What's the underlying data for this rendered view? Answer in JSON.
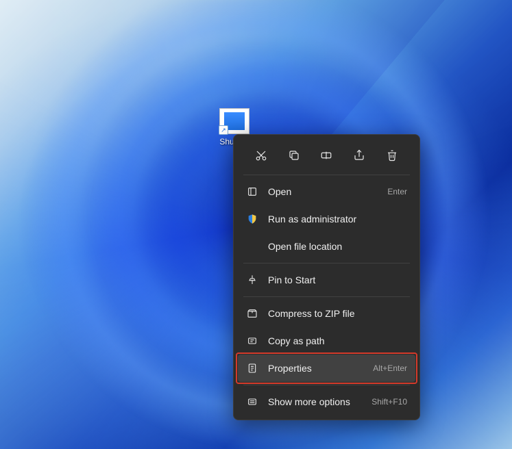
{
  "desktop": {
    "icon_label": "Shutdown",
    "icon_label_truncated": "Shutd…"
  },
  "context_menu": {
    "top_actions": [
      {
        "name": "cut-icon"
      },
      {
        "name": "copy-icon"
      },
      {
        "name": "rename-icon"
      },
      {
        "name": "share-icon"
      },
      {
        "name": "delete-icon"
      }
    ],
    "items": [
      {
        "label": "Open",
        "shortcut": "Enter",
        "icon": "open-icon",
        "highlighted": false
      },
      {
        "label": "Run as administrator",
        "shortcut": "",
        "icon": "shield-icon",
        "highlighted": false
      },
      {
        "label": "Open file location",
        "shortcut": "",
        "icon": "",
        "highlighted": false
      },
      {
        "label": "Pin to Start",
        "shortcut": "",
        "icon": "pin-icon",
        "highlighted": false
      },
      {
        "label": "Compress to ZIP file",
        "shortcut": "",
        "icon": "zip-icon",
        "highlighted": false
      },
      {
        "label": "Copy as path",
        "shortcut": "",
        "icon": "path-icon",
        "highlighted": false
      },
      {
        "label": "Properties",
        "shortcut": "Alt+Enter",
        "icon": "properties-icon",
        "highlighted": true
      },
      {
        "label": "Show more options",
        "shortcut": "Shift+F10",
        "icon": "more-icon",
        "highlighted": false
      }
    ]
  },
  "colors": {
    "menu_bg": "#2c2c2c",
    "highlight_border": "#d43a2a"
  }
}
